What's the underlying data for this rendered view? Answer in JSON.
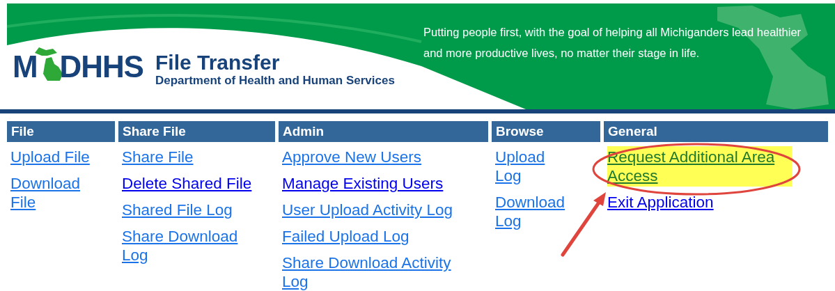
{
  "header": {
    "logo_parts": [
      "M",
      "DHHS"
    ],
    "title": "File Transfer",
    "subtitle": "Department of Health and Human Services",
    "tagline": "Putting people first, with the goal of helping all Michiganders lead healthier and more productive lives, no matter their stage in life."
  },
  "menu": [
    {
      "heading": "File",
      "links": [
        {
          "label": "Upload File",
          "visited": true,
          "highlighted": false
        },
        {
          "label": "Download File",
          "visited": true,
          "highlighted": false
        }
      ]
    },
    {
      "heading": "Share File",
      "links": [
        {
          "label": "Share File",
          "visited": true,
          "highlighted": false
        },
        {
          "label": "Delete Shared File",
          "visited": false,
          "highlighted": false
        },
        {
          "label": "Shared File Log",
          "visited": true,
          "highlighted": false
        },
        {
          "label": "Share Download Log",
          "visited": true,
          "highlighted": false
        }
      ]
    },
    {
      "heading": "Admin",
      "links": [
        {
          "label": "Approve New Users",
          "visited": true,
          "highlighted": false
        },
        {
          "label": "Manage Existing Users",
          "visited": false,
          "highlighted": false
        },
        {
          "label": "User Upload Activity Log",
          "visited": true,
          "highlighted": false
        },
        {
          "label": "Failed Upload Log",
          "visited": true,
          "highlighted": false
        },
        {
          "label": "Share Download Activity Log",
          "visited": true,
          "highlighted": false
        }
      ]
    },
    {
      "heading": "Browse",
      "links": [
        {
          "label": "Upload Log",
          "visited": true,
          "highlighted": false
        },
        {
          "label": "Download Log",
          "visited": true,
          "highlighted": false
        }
      ]
    },
    {
      "heading": "General",
      "links": [
        {
          "label": "Request Additional Area Access",
          "highlighted": true
        },
        {
          "label": "Exit Application",
          "visited": false,
          "highlighted": false
        }
      ]
    }
  ]
}
